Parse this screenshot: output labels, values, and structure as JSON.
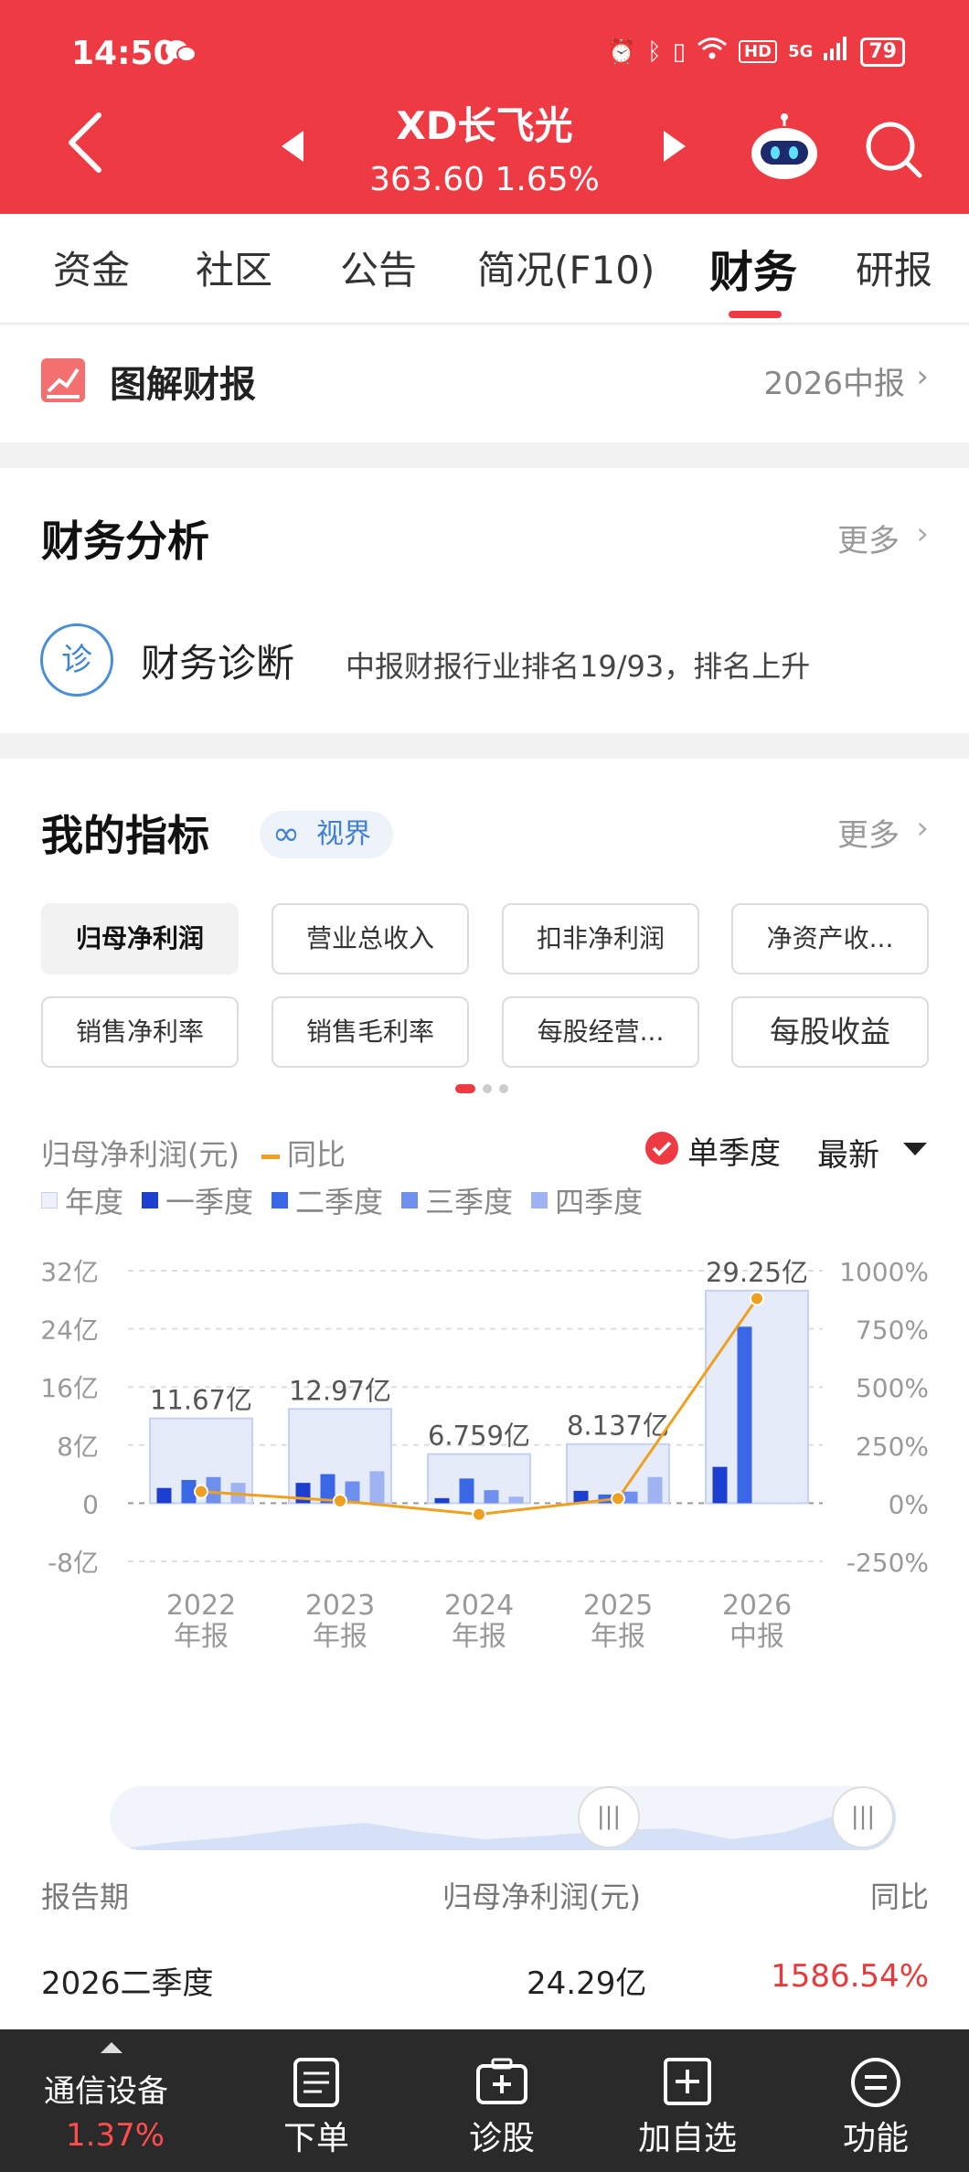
{
  "status_bar": {
    "time": "14:50",
    "hd": "HD",
    "signal": "5G",
    "battery": "79"
  },
  "header": {
    "stock_name": "XD长飞光",
    "price_line": "363.60 1.65%"
  },
  "tabs": [
    "资金",
    "社区",
    "公告",
    "简况(F10)",
    "财务",
    "研报"
  ],
  "active_tab": "财务",
  "report": {
    "title": "图解财报",
    "link": "2026中报"
  },
  "analysis": {
    "title": "财务分析",
    "more": "更多",
    "diagnosis_icon": "诊",
    "diagnosis_title": "财务诊断",
    "diagnosis_desc": "中报财报行业排名19/93，排名上升"
  },
  "indicators": {
    "title": "我的指标",
    "vision": "视界",
    "more": "更多",
    "chips": [
      "归母净利润",
      "营业总收入",
      "扣非净利润",
      "净资产收...",
      "销售净利率",
      "销售毛利率",
      "每股经营...",
      "每股收益"
    ]
  },
  "chart_controls": {
    "metric_label": "归母净利润(元)",
    "yoy_label": "同比",
    "single_quarter": "单季度",
    "latest": "最新",
    "legend": [
      "年度",
      "一季度",
      "二季度",
      "三季度",
      "四季度"
    ]
  },
  "colors": {
    "accent": "#ee3a43",
    "annual": "#e6ebfa",
    "q1": "#1d3fcf",
    "q2": "#3a67e6",
    "q3": "#6f8fee",
    "q4": "#9fb3f3",
    "yoy": "#f0a020"
  },
  "chart_data": {
    "type": "bar",
    "categories": [
      [
        "2022",
        "年报"
      ],
      [
        "2023",
        "年报"
      ],
      [
        "2024",
        "年报"
      ],
      [
        "2025",
        "年报"
      ],
      [
        "2026",
        "中报"
      ]
    ],
    "annual_labels": [
      "11.67亿",
      "12.97亿",
      "6.759亿",
      "8.137亿",
      "29.25亿"
    ],
    "annual_values": [
      11.67,
      12.97,
      6.759,
      8.137,
      29.25
    ],
    "series": [
      {
        "name": "一季度",
        "values": [
          2.1,
          2.8,
          0.7,
          1.7,
          5.0
        ]
      },
      {
        "name": "二季度",
        "values": [
          3.2,
          4.0,
          3.4,
          1.2,
          24.29
        ]
      },
      {
        "name": "三季度",
        "values": [
          3.6,
          3.0,
          1.8,
          1.6,
          null
        ]
      },
      {
        "name": "四季度",
        "values": [
          2.8,
          4.4,
          0.9,
          3.6,
          null
        ]
      }
    ],
    "yoy": {
      "name": "同比",
      "values": [
        50,
        10,
        -48,
        20,
        880
      ]
    },
    "y_left": {
      "ticks": [
        "32亿",
        "24亿",
        "16亿",
        "8亿",
        "0",
        "-8亿"
      ],
      "range": [
        -8,
        32
      ]
    },
    "y_right": {
      "ticks": [
        "1000%",
        "750%",
        "500%",
        "250%",
        "0%",
        "-250%"
      ],
      "range": [
        -250,
        1000
      ]
    },
    "grid": true
  },
  "table": {
    "headers": [
      "报告期",
      "归母净利润(元)",
      "同比"
    ],
    "rows": [
      [
        "2026二季度",
        "24.29亿",
        "1586.54%"
      ]
    ]
  },
  "bottom_nav": {
    "industry_name": "通信设备",
    "industry_change": "1.37%",
    "items": [
      "下单",
      "诊股",
      "加自选",
      "功能"
    ]
  }
}
